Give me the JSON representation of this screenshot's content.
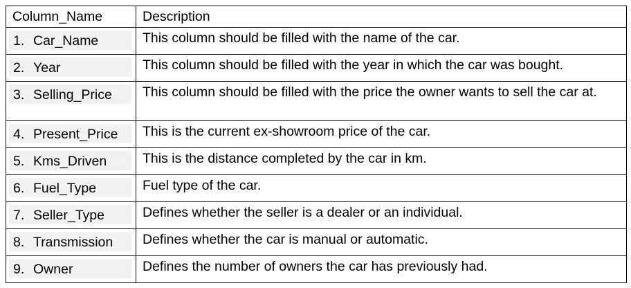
{
  "table": {
    "headers": [
      "Column_Name",
      "Description"
    ],
    "rows": [
      {
        "num": "1.",
        "name": "Car_Name",
        "description": "This column should be filled with the name of the car."
      },
      {
        "num": "2.",
        "name": "Year",
        "description": "This column should be filled with the year in which the car was bought."
      },
      {
        "num": "3.",
        "name": "Selling_Price",
        "description": "This column should be filled with the price the owner wants to sell the car at."
      },
      {
        "num": "4.",
        "name": "Present_Price",
        "description": "This is the current ex-showroom price of the car."
      },
      {
        "num": "5.",
        "name": "Kms_Driven",
        "description": "This is the distance completed by the car in km."
      },
      {
        "num": "6.",
        "name": "Fuel_Type",
        "description": "Fuel type of the car."
      },
      {
        "num": "7.",
        "name": "Seller_Type",
        "description": "Defines whether the seller is a dealer or an individual."
      },
      {
        "num": "8.",
        "name": "Transmission",
        "description": "Defines whether the car is manual or automatic."
      },
      {
        "num": "9.",
        "name": "Owner",
        "description": "Defines the number of owners the car has previously had."
      }
    ]
  }
}
